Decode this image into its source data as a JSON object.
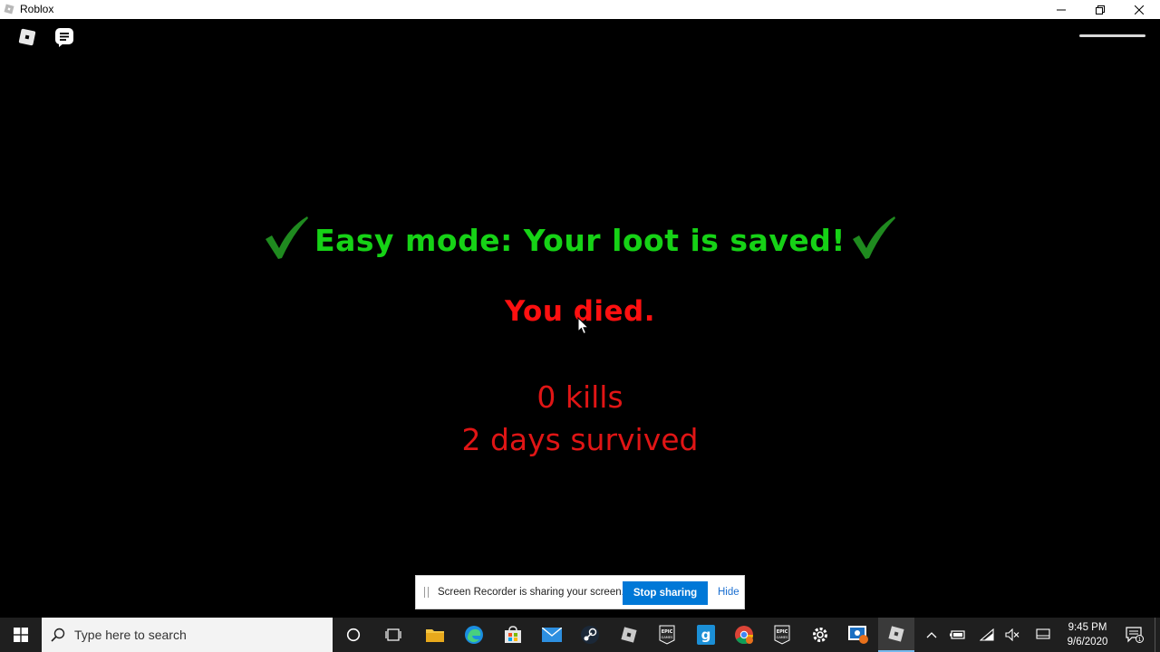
{
  "window": {
    "title": "Roblox",
    "icon": "roblox-icon",
    "controls": [
      "minimize-icon",
      "restore-icon",
      "close-icon"
    ]
  },
  "game": {
    "top_icons": [
      "roblox-menu-icon",
      "chat-icon"
    ],
    "easy_mode_message": "Easy mode: Your loot is saved!",
    "death_message": "You died.",
    "kills": "0 kills",
    "days_survived": "2 days survived",
    "colors": {
      "easy": "#16d216",
      "died": "#ff1010",
      "stats": "#e01515"
    }
  },
  "screen_recorder": {
    "message": "Screen Recorder is sharing your screen.",
    "stop_label": "Stop sharing",
    "hide_label": "Hide"
  },
  "taskbar": {
    "search_placeholder": "Type here to search",
    "pinned": [
      "cortana-icon",
      "task-view-icon",
      "file-explorer-icon",
      "edge-icon",
      "store-icon",
      "mail-icon",
      "steam-icon",
      "roblox-studio-icon",
      "epic-games-icon",
      "g-app-icon",
      "chrome-icon",
      "epic-games-icon",
      "settings-icon",
      "monitor-app-icon",
      "roblox-icon"
    ],
    "tray": [
      "chevron-up-icon",
      "battery-icon",
      "wifi-icon",
      "volume-muted-icon",
      "display-icon"
    ],
    "time": "9:45 PM",
    "date": "9/6/2020",
    "notification_count": "1"
  }
}
